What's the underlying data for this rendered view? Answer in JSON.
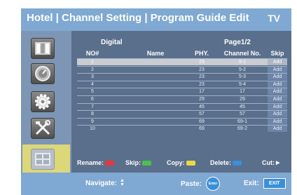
{
  "header": {
    "title": "Hotel | Channel Setting | Program Guide Edit",
    "mode": "TV"
  },
  "sections": {
    "left": "Digital",
    "right": "Page1/2"
  },
  "table": {
    "columns": [
      "NO#",
      "Name",
      "PHY.",
      "Channel No.",
      "Skip"
    ],
    "rows": [
      {
        "no": "1",
        "name": "",
        "phy": "23",
        "ch": "5-1",
        "skip": "Add"
      },
      {
        "no": "2",
        "name": "",
        "phy": "23",
        "ch": "5-2",
        "skip": "Add"
      },
      {
        "no": "3",
        "name": "",
        "phy": "23",
        "ch": "5-3",
        "skip": "Add"
      },
      {
        "no": "4",
        "name": "",
        "phy": "23",
        "ch": "5-4",
        "skip": "Add"
      },
      {
        "no": "5",
        "name": "",
        "phy": "17",
        "ch": "17",
        "skip": "Add"
      },
      {
        "no": "6",
        "name": "",
        "phy": "29",
        "ch": "29",
        "skip": "Add"
      },
      {
        "no": "7",
        "name": "",
        "phy": "45",
        "ch": "45",
        "skip": "Add"
      },
      {
        "no": "8",
        "name": "",
        "phy": "57",
        "ch": "57",
        "skip": "Add"
      },
      {
        "no": "9",
        "name": "",
        "phy": "69",
        "ch": "69-1",
        "skip": "Add"
      },
      {
        "no": "10",
        "name": "",
        "phy": "69",
        "ch": "69-2",
        "skip": "Add"
      }
    ]
  },
  "legend": {
    "rename": "Rename:",
    "skip": "Skip:",
    "copy": "Copy:",
    "delete": "Delete:",
    "cut": "Cut:",
    "rename_color": "#e8363d",
    "skip_color": "#4dbf4d",
    "copy_color": "#e8d84a",
    "delete_color": "#3b8fd9"
  },
  "footer": {
    "navigate": "Navigate:",
    "paste": "Paste:",
    "enter": "Enter",
    "exit": "Exit:",
    "exit_button": "EXIT"
  },
  "sidebar_icons": [
    "channel-list-icon",
    "signal-dial-icon",
    "settings-gear-icon",
    "tools-icon",
    "program-guide-icon"
  ],
  "colors": {
    "header": "#7fa8d2",
    "panel": "#5a6f8c",
    "sidebar": "#7d96b6",
    "selected_tab": "#dcd778",
    "selected_row": "#c9cdd2"
  }
}
